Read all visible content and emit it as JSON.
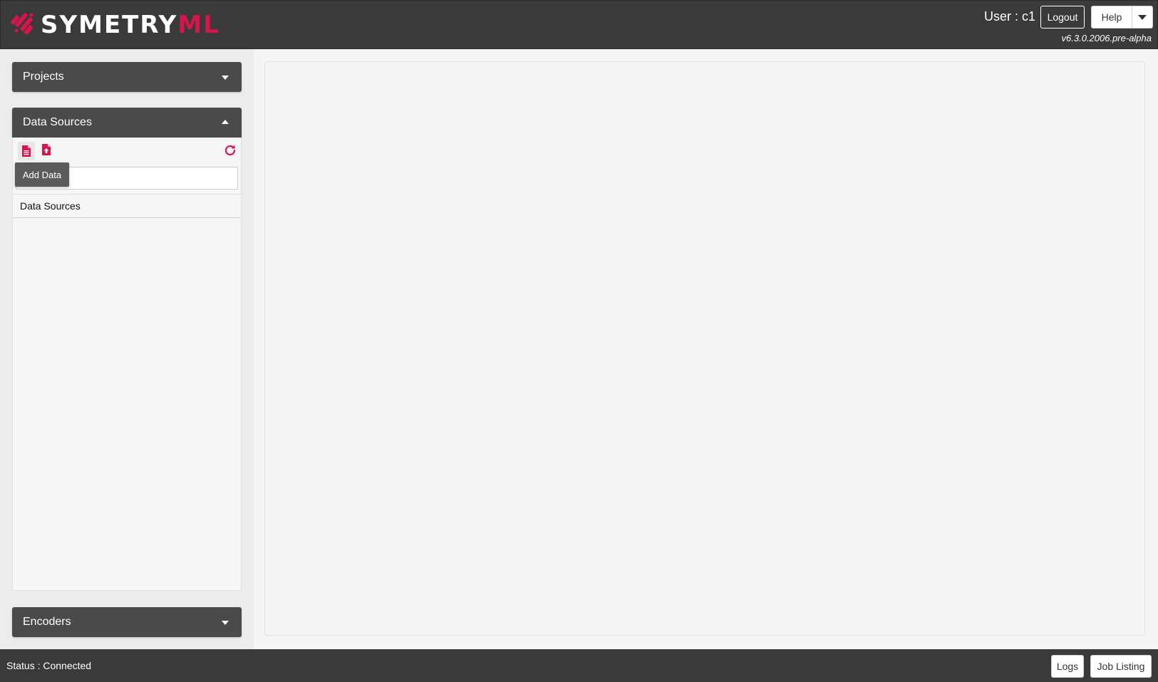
{
  "app": {
    "brand_main": "SYMETRY",
    "brand_accent": "ML",
    "accent_color": "#d4164b",
    "header_color": "#3a3a3a"
  },
  "header": {
    "user_label": "User : c1",
    "logout_label": "Logout",
    "help_label": "Help",
    "version": "v6.3.0.2006.pre-alpha"
  },
  "sidebar": {
    "projects_label": "Projects",
    "data_sources_label": "Data Sources",
    "encoders_label": "Encoders",
    "data_sources": {
      "tooltip": "Add Data",
      "list_header": "Data Sources",
      "search_value": "",
      "icons": [
        "add-data-icon",
        "upload-file-icon",
        "refresh-icon"
      ]
    }
  },
  "status_bar": {
    "status_text": "Status : Connected",
    "logs_label": "Logs",
    "job_listing_label": "Job Listing"
  }
}
